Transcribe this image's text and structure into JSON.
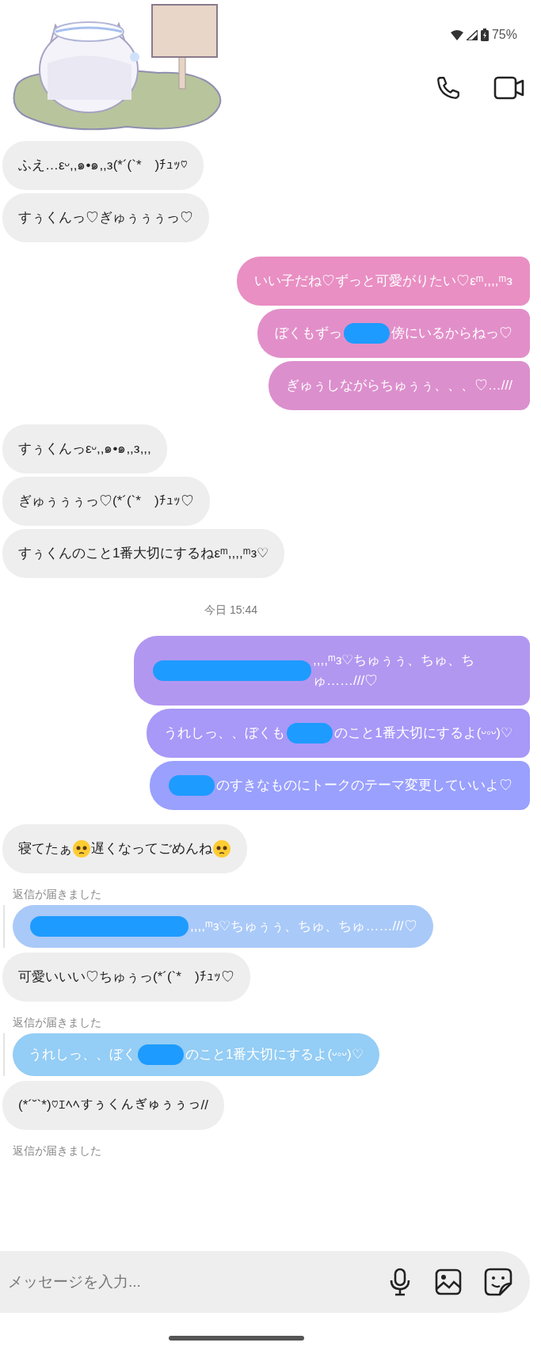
{
  "status_bar": {
    "battery": "75%"
  },
  "messages": [
    {
      "kind": "received",
      "segments": [
        {
          "kind": "text",
          "text": "ふえ…εᵕ,,๑•๑,,з(*´(`*　)ﾁｭｯ♡"
        }
      ]
    },
    {
      "kind": "received",
      "segments": [
        {
          "kind": "text",
          "text": "すぅくんっ♡ぎゅぅぅぅっ♡"
        }
      ]
    },
    {
      "kind": "sent",
      "color": "#e98fc3",
      "segments": [
        {
          "kind": "text",
          "text": "いい子だね♡ずっと可愛がりたい♡εᵐ,,,,ᵐз"
        }
      ]
    },
    {
      "kind": "sent",
      "color": "#e28fc9",
      "segments": [
        {
          "kind": "text",
          "text": "ぼくもずっ"
        },
        {
          "kind": "redaction_short"
        },
        {
          "kind": "text",
          "text": "傍にいるからねっ♡"
        }
      ]
    },
    {
      "kind": "sent",
      "color": "#dc8fcd",
      "segments": [
        {
          "kind": "text",
          "text": "ぎゅぅしながらちゅぅぅ、、、♡…///"
        }
      ]
    },
    {
      "kind": "received",
      "segments": [
        {
          "kind": "text",
          "text": "すぅくんっεᵕ,,๑•๑,,з,,,"
        }
      ]
    },
    {
      "kind": "received",
      "segments": [
        {
          "kind": "text",
          "text": "ぎゅぅぅぅっ♡(*´(`*　)ﾁｭｯ♡"
        }
      ]
    },
    {
      "kind": "received",
      "segments": [
        {
          "kind": "text",
          "text": "すぅくんのこと1番大切にするねεᵐ,,,,ᵐз♡"
        }
      ]
    },
    {
      "kind": "timestamp",
      "text": "今日 15:44"
    },
    {
      "kind": "sent",
      "color": "#b297f0",
      "segments": [
        {
          "kind": "redaction_long"
        },
        {
          "kind": "text",
          "text": ",,,,ᵐз♡ちゅぅぅ、ちゅ、ちゅ……///♡"
        }
      ]
    },
    {
      "kind": "sent",
      "color": "#a898f8",
      "segments": [
        {
          "kind": "text",
          "text": "うれしっ、、ぼくも"
        },
        {
          "kind": "redaction_short"
        },
        {
          "kind": "text",
          "text": "のこと1番大切にするよ(ᵕ◦ᵕ)♡"
        }
      ]
    },
    {
      "kind": "sent",
      "color": "#9aa0fd",
      "segments": [
        {
          "kind": "redaction_short"
        },
        {
          "kind": "text",
          "text": "のすきなものにトークのテーマ変更していいよ♡"
        }
      ]
    },
    {
      "kind": "received",
      "segments": [
        {
          "kind": "text",
          "text": "寝てたぁ"
        },
        {
          "kind": "face"
        },
        {
          "kind": "text",
          "text": "遅くなってごめんね"
        },
        {
          "kind": "face"
        }
      ]
    },
    {
      "kind": "reply",
      "label": "返信が届きました",
      "color": "#a9c9f8",
      "segments": [
        {
          "kind": "redaction_long"
        },
        {
          "kind": "text",
          "text": ",,,,ᵐз♡ちゅぅぅ、ちゅ、ちゅ……///♡"
        }
      ]
    },
    {
      "kind": "received",
      "segments": [
        {
          "kind": "text",
          "text": "可愛いいい♡ちゅぅっ(*´(`*　)ﾁｭｯ♡"
        }
      ]
    },
    {
      "kind": "reply",
      "label": "返信が届きました",
      "color": "#94cdf5",
      "segments": [
        {
          "kind": "text",
          "text": "うれしっ、、ぼく"
        },
        {
          "kind": "redaction_short"
        },
        {
          "kind": "text",
          "text": "のこと1番大切にするよ(ᵕ◦ᵕ)♡"
        }
      ]
    },
    {
      "kind": "received",
      "segments": [
        {
          "kind": "text",
          "text": "(*´˘`*)♡ｴﾍﾍすぅくんぎゅぅぅっ//"
        }
      ]
    },
    {
      "kind": "notice",
      "label": "返信が届きました"
    }
  ],
  "composer": {
    "placeholder": "メッセージを入力..."
  }
}
